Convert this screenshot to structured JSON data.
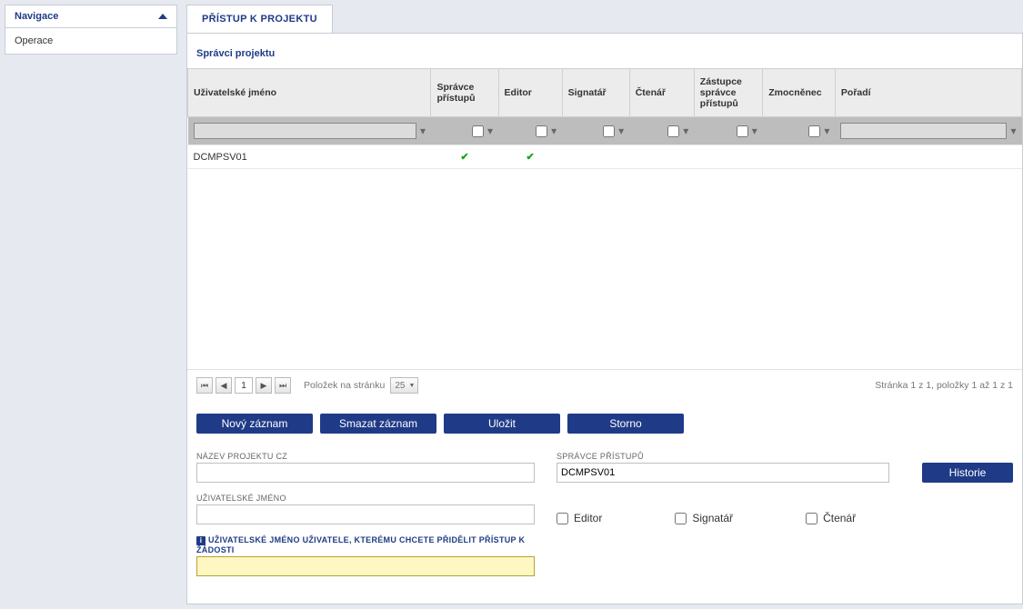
{
  "sidebar": {
    "nav_title": "Navigace",
    "items": [
      {
        "label": "Operace"
      }
    ]
  },
  "tab": {
    "label": "PŘÍSTUP K PROJEKTU"
  },
  "section": {
    "title": "Správci projektu"
  },
  "grid": {
    "headers": {
      "username": "Uživatelské jméno",
      "admin": "Správce přístupů",
      "editor": "Editor",
      "signatory": "Signatář",
      "reader": "Čtenář",
      "deputy": "Zástupce správce přístupů",
      "proxy": "Zmocněnec",
      "order": "Pořadí"
    },
    "rows": [
      {
        "username": "DCMPSV01",
        "admin": true,
        "editor": true,
        "signatory": false,
        "reader": false,
        "deputy": false,
        "proxy": false,
        "order": ""
      }
    ]
  },
  "pager": {
    "page": "1",
    "per_label": "Položek na stránku",
    "per_value": "25",
    "summary": "Stránka 1 z 1, položky 1 až 1 z 1"
  },
  "actions": {
    "new": "Nový záznam",
    "delete": "Smazat záznam",
    "save": "Uložit",
    "cancel": "Storno"
  },
  "form": {
    "project_name_label": "NÁZEV PROJEKTU CZ",
    "project_name_value": "",
    "admin_label": "SPRÁVCE PŘÍSTUPŮ",
    "admin_value": "DCMPSV01",
    "history": "Historie",
    "username_label": "UŽIVATELSKÉ JMÉNO",
    "username_value": "",
    "editor_label": "Editor",
    "signatory_label": "Signatář",
    "reader_label": "Čtenář",
    "assign_label": "UŽIVATELSKÉ JMÉNO UŽIVATELE, KTERÉMU CHCETE PŘIDĚLIT PŘÍSTUP K ŽÁDOSTI",
    "assign_value": ""
  }
}
